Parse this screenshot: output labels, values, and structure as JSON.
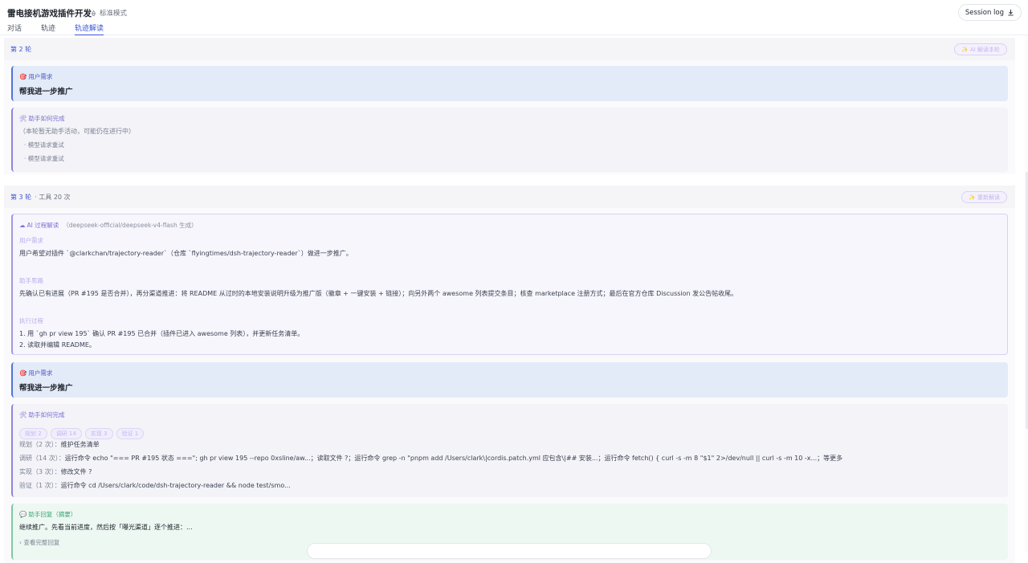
{
  "header": {
    "title": "雷电接机游戏插件开发",
    "mode": "标准模式",
    "session_log": "Session log",
    "tabs": [
      "对话",
      "轨迹",
      "轨迹解读"
    ],
    "active_tab": 2
  },
  "round2": {
    "title": "第 2 轮",
    "button": "✨ AI 解读本轮",
    "request": {
      "label": "用户需求",
      "text": "帮我进一步推广"
    },
    "how": {
      "label": "助手如何完成",
      "lines": [
        "（本轮暂无助手活动，可能仍在进行中）",
        "· 模型请求重试",
        "· 模型请求重试"
      ]
    }
  },
  "round3": {
    "title": "第 3 轮",
    "sub": "· 工具 20 次",
    "button": "✨ 重新解读",
    "ai": {
      "label": "AI 过程解读",
      "model": "（deepseek-official/deepseek-v4-flash 生成）",
      "user_need_title": "用户需求",
      "user_need": "用户希望对插件 `@clarkchan/trajectory-reader`（仓库 `flyingtimes/dsh-trajectory-reader`）做进一步推广。",
      "thinking_title": "助手思路",
      "thinking": "先确认已有进展（PR #195 是否合并），再分渠道推进：将 README 从过时的本地安装说明升级为推广版（徽章 + 一键安装 + 链接）；向另外两个 awesome 列表提交条目；核查 marketplace 注册方式；最后在官方仓库 Discussion 发公告帖收尾。",
      "process_title": "执行过程",
      "process": [
        "1. 用 `gh pr view 195` 确认 PR #195 已合并（插件已进入 awesome 列表），并更新任务清单。",
        "2. 读取并编辑 README。"
      ]
    },
    "request": {
      "label": "用户需求",
      "text": "帮我进一步推广"
    },
    "how": {
      "label": "助手如何完成",
      "chips": [
        "规划 2",
        "调研 14",
        "实现 3",
        "验证 1"
      ],
      "lines": [
        {
          "k": "规划（2 次）：",
          "v": "维护任务清单"
        },
        {
          "k": "调研（14 次）：",
          "v": "运行命令 echo \"=== PR #195 状态 ===\"; gh pr view 195 --repo 0xsline/aw...；读取文件 ?；运行命令 grep -n \"pnpm add /Users/clark\\|cordis.patch.yml 应包含\\|## 安装...；运行命令 fetch() { curl -s -m 8 \"$1\" 2>/dev/null || curl -s -m 10 -x...；等更多"
        },
        {
          "k": "实现（3 次）：",
          "v": "修改文件 ?"
        },
        {
          "k": "验证（1 次）：",
          "v": "运行命令 cd /Users/clark/code/dsh-trajectory-reader && node test/smo..."
        }
      ]
    },
    "reply": {
      "label": "助手回复（摘要）",
      "text": "继续推广。先看当前进度，然后按「曝光渠道」逐个推进：...",
      "more": "› 查看完整回复"
    }
  }
}
